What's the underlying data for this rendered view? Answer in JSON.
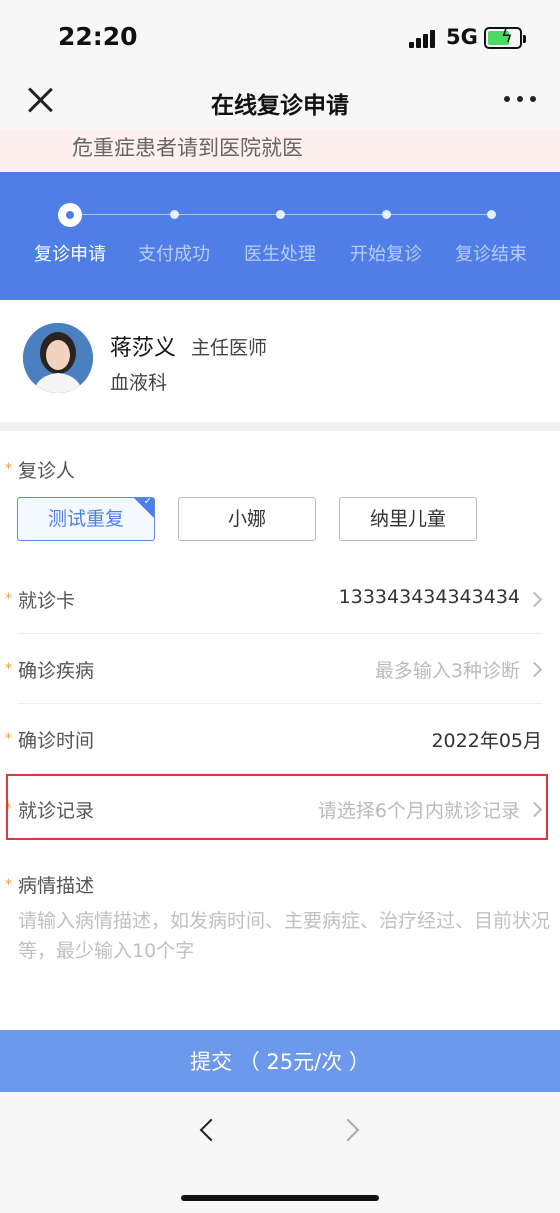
{
  "status_bar": {
    "time": "22:20",
    "network": "5G"
  },
  "nav": {
    "title": "在线复诊申请"
  },
  "warning": {
    "text": "危重症患者请到医院就医"
  },
  "steps": [
    {
      "label": "复诊申请",
      "active": true
    },
    {
      "label": "支付成功",
      "active": false
    },
    {
      "label": "医生处理",
      "active": false
    },
    {
      "label": "开始复诊",
      "active": false
    },
    {
      "label": "复诊结束",
      "active": false
    }
  ],
  "doctor": {
    "name": "蒋莎义",
    "title": "主任医师",
    "department": "血液科"
  },
  "form": {
    "required_mark": "*",
    "patient": {
      "label": "复诊人",
      "options": [
        {
          "label": "测试重复",
          "selected": true
        },
        {
          "label": "小娜",
          "selected": false
        },
        {
          "label": "纳里儿童",
          "selected": false
        }
      ],
      "selected_mark": "✓"
    },
    "card": {
      "label": "就诊卡",
      "value": "133343434343434"
    },
    "disease": {
      "label": "确诊疾病",
      "placeholder": "最多输入3种诊断"
    },
    "diagnosis_time": {
      "label": "确诊时间",
      "value": "2022年05月"
    },
    "visit_record": {
      "label": "就诊记录",
      "placeholder": "请选择6个月内就诊记录"
    },
    "description": {
      "label": "病情描述",
      "placeholder": "请输入病情描述，如发病时间、主要病症、治疗经过、目前状况等，最少输入10个字"
    }
  },
  "submit": {
    "label": "提交 （ 25元/次 ）"
  },
  "colors": {
    "primary": "#4f7fe6",
    "submit": "#6c99ec",
    "required": "#e6a23c",
    "highlight": "#d83b3b"
  }
}
